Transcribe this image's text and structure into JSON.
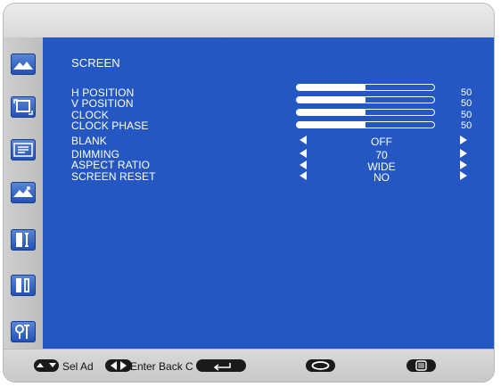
{
  "menu": {
    "heading": "SCREEN",
    "sliders": [
      {
        "label": "H POSITION",
        "value": "50",
        "level": 0.5
      },
      {
        "label": "V POSITION",
        "value": "50",
        "level": 0.5
      },
      {
        "label": "CLOCK",
        "value": "50",
        "level": 0.5
      },
      {
        "label": "CLOCK PHASE",
        "value": "50",
        "level": 0.5
      }
    ],
    "options": [
      {
        "label": "BLANK",
        "value": "OFF"
      },
      {
        "label": "DIMMING",
        "value": "70"
      },
      {
        "label": "ASPECT RATIO",
        "value": "WIDE"
      },
      {
        "label": "SCREEN RESET",
        "value": "NO"
      }
    ]
  },
  "sidebar": {
    "icons": [
      "picture-icon",
      "screen-icon",
      "pip-icon",
      "audio-icon",
      "settings-icon",
      "advanced-icon",
      "tools-icon"
    ]
  },
  "footer": {
    "hint": "Sel Ad",
    "enter_label": "Enter Back C"
  },
  "colors": {
    "panel_blue": "#2457c1",
    "icon_blue": "#1f4fb4",
    "text": "#ffffff"
  }
}
